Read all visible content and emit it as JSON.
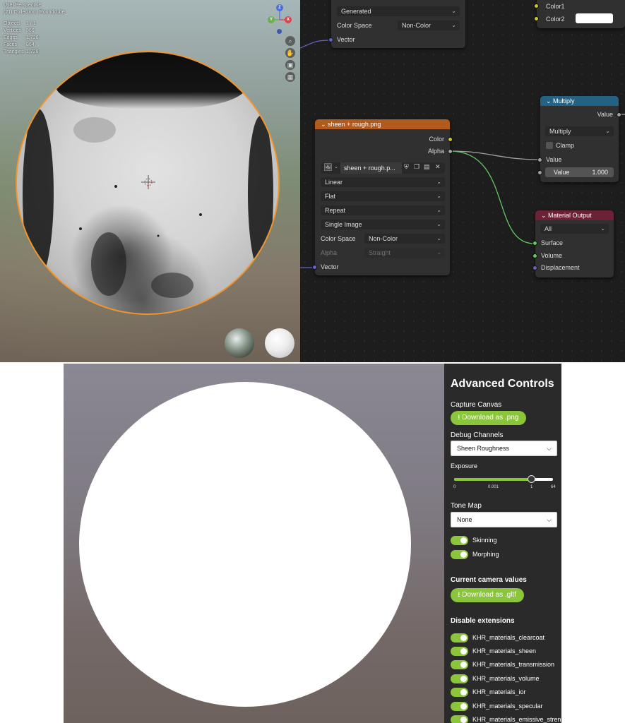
{
  "blender_viewport": {
    "view_name": "User Perspective",
    "collection": "(21) Collection | Roundcube",
    "stats": [
      {
        "label": "Objects",
        "value": "1 / 1"
      },
      {
        "label": "Vertices",
        "value": "866"
      },
      {
        "label": "Edges",
        "value": "1,728"
      },
      {
        "label": "Faces",
        "value": "864"
      },
      {
        "label": "Triangles",
        "value": "1,728"
      }
    ],
    "gizmo": {
      "z": "Z",
      "y": "Y",
      "x": "X"
    },
    "nav_icons": [
      "zoom-icon",
      "hand-pan-icon",
      "camera-icon",
      "grid-icon"
    ]
  },
  "node_editor": {
    "top_node": {
      "generated": "Generated",
      "color_space_label": "Color Space",
      "color_space_value": "Non-Color",
      "vector": "Vector"
    },
    "mix_node": {
      "color1": "Color1",
      "color2": "Color2"
    },
    "image_node": {
      "title": "sheen + rough.png",
      "out_color": "Color",
      "out_alpha": "Alpha",
      "image_name": "sheen + rough.p...",
      "interpolation": "Linear",
      "projection": "Flat",
      "extension": "Repeat",
      "source": "Single Image",
      "color_space_label": "Color Space",
      "color_space_value": "Non-Color",
      "alpha_label": "Alpha",
      "alpha_value": "Straight",
      "vector": "Vector"
    },
    "multiply_node": {
      "title": "Multiply",
      "out_value": "Value",
      "operation": "Multiply",
      "clamp": "Clamp",
      "in_value": "Value",
      "field_label": "Value",
      "field_value": "1.000"
    },
    "output_node": {
      "title": "Material Output",
      "target": "All",
      "surface": "Surface",
      "volume": "Volume",
      "displacement": "Displacement"
    }
  },
  "controls": {
    "title": "Advanced Controls",
    "capture_label": "Capture Canvas",
    "download_png": "Download as .png",
    "debug_label": "Debug Channels",
    "debug_value": "Sheen Roughness",
    "exposure_label": "Exposure",
    "exposure_ticks": [
      "0",
      "0.001",
      "1",
      "64"
    ],
    "exposure_position": 0.78,
    "tonemap_label": "Tone Map",
    "tonemap_value": "None",
    "skinning": "Skinning",
    "morphing": "Morphing",
    "camera_label": "Current camera values",
    "download_gltf": "Download as .gltf",
    "extensions_label": "Disable extensions",
    "extensions": [
      "KHR_materials_clearcoat",
      "KHR_materials_sheen",
      "KHR_materials_transmission",
      "KHR_materials_volume",
      "KHR_materials_ior",
      "KHR_materials_specular",
      "KHR_materials_emissive_strength"
    ]
  },
  "colors": {
    "accent_green": "#8ac53c",
    "selection_orange": "#f2942c",
    "panel_bg": "#2a2a2a"
  }
}
